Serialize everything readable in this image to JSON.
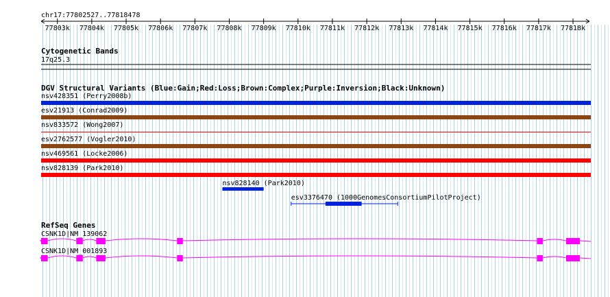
{
  "ruler": {
    "region": "chr17:77802527..77818478",
    "start": 77802527,
    "end": 77818478,
    "tick_labels": [
      "77803k",
      "77804k",
      "77805k",
      "77806k",
      "77807k",
      "77808k",
      "77809k",
      "77810k",
      "77811k",
      "77812k",
      "77813k",
      "77814k",
      "77815k",
      "77816k",
      "77817k",
      "77818k"
    ]
  },
  "tracks": {
    "cytoband": {
      "title": "Cytogenetic Bands",
      "band": "17q25.3"
    },
    "dgv": {
      "title": "DGV Structural Variants (Blue:Gain;Red:Loss;Brown:Complex;Purple:Inversion;Black:Unknown)",
      "colors": {
        "gain": "#0022dd",
        "loss": "#ff0000",
        "complex": "#8b4513"
      },
      "features": [
        {
          "name": "nsv428351 (Perry2008b)",
          "type": "gain",
          "start": 77802527,
          "end": 77818478
        },
        {
          "name": "esv21913 (Conrad2009)",
          "type": "complex",
          "start": 77802527,
          "end": 77818478
        },
        {
          "name": "nsv833572 (Wong2007)",
          "type": "loss",
          "start": 77802527,
          "end": 77818478
        },
        {
          "name": "esv2762577 (Vogler2010)",
          "type": "complex",
          "start": 77802527,
          "end": 77818478
        },
        {
          "name": "nsv469561 (Locke2006)",
          "type": "loss",
          "start": 77802527,
          "end": 77818478
        },
        {
          "name": "nsv828139 (Park2010)",
          "type": "loss",
          "start": 77802527,
          "end": 77818478
        },
        {
          "name": "nsv828140 (Park2010)",
          "type": "gain",
          "start": 77807800,
          "end": 77809000
        },
        {
          "name": "esv3376470 (1000GenomesConsortiumPilotProject)",
          "type": "gain",
          "start": 77809800,
          "end": 77812900,
          "inner_start": 77810800,
          "inner_end": 77811850
        }
      ]
    },
    "refseq": {
      "title": "RefSeq Genes",
      "color": "#ff00ff",
      "transcripts": [
        {
          "name": "CSNK1D|NM_139062",
          "exons": [
            [
              77802527,
              77802720
            ],
            [
              77803550,
              77803740
            ],
            [
              77804130,
              77804400
            ],
            [
              77806480,
              77806650
            ],
            [
              77816950,
              77817120
            ],
            [
              77817800,
              77818200
            ]
          ]
        },
        {
          "name": "CSNK1D|NM_001893",
          "exons": [
            [
              77802527,
              77802720
            ],
            [
              77803550,
              77803740
            ],
            [
              77804130,
              77804400
            ],
            [
              77806480,
              77806650
            ],
            [
              77816950,
              77817120
            ],
            [
              77817800,
              77818200
            ]
          ]
        }
      ]
    }
  },
  "icons": {
    "left_arrow": "arrow-left-icon",
    "right_arrow": "arrow-right-icon"
  }
}
